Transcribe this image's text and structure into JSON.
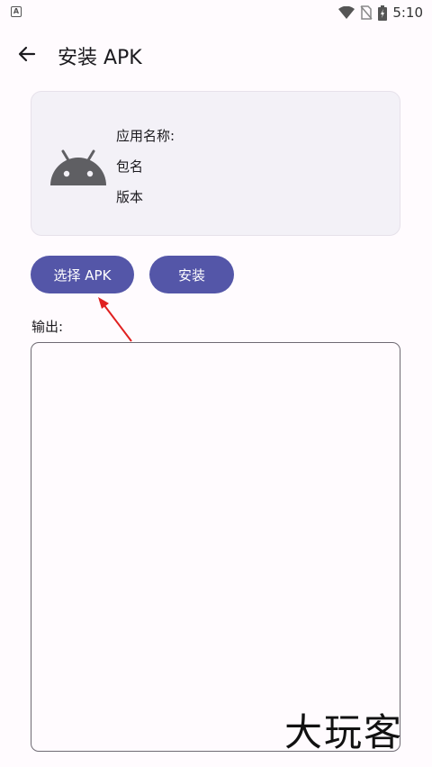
{
  "status_bar": {
    "time": "5:10",
    "left_icon_letter": "A"
  },
  "header": {
    "title": "安装 APK"
  },
  "app_info": {
    "name_label": "应用名称:",
    "package_label": "包名",
    "version_label": "版本"
  },
  "buttons": {
    "select": "选择 APK",
    "install": "安装"
  },
  "output": {
    "label": "输出:",
    "content": ""
  },
  "watermark": "大玩客",
  "colors": {
    "accent": "#5456a8",
    "arrow": "#e02020",
    "background": "#fffbfe",
    "card": "#f3f1f7"
  }
}
